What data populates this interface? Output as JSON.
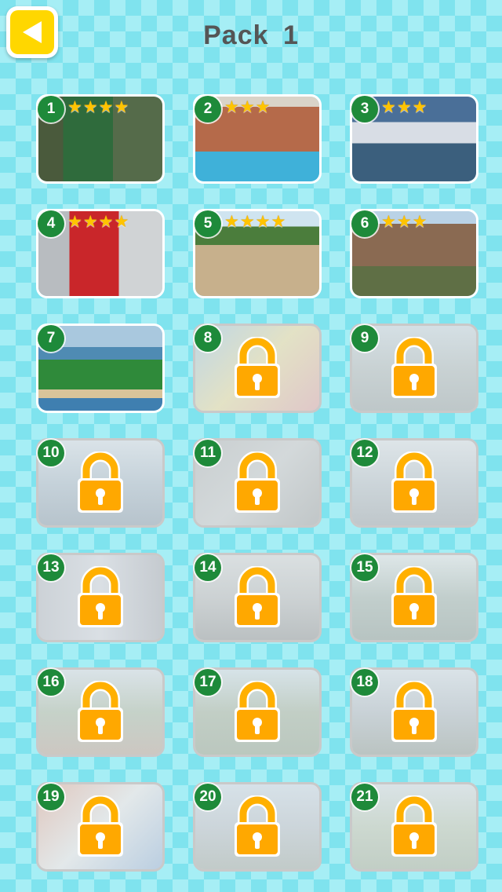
{
  "header": {
    "title": "Pack  1",
    "back_icon": "back-arrow-icon"
  },
  "colors": {
    "accent": "#ffd700",
    "badge": "#1e8a3a",
    "star": "#ffc400",
    "lock": "#ffa800"
  },
  "levels": [
    {
      "number": "1",
      "locked": false,
      "stars": 4,
      "scene": "cafe"
    },
    {
      "number": "2",
      "locked": false,
      "stars": 3,
      "scene": "pool"
    },
    {
      "number": "3",
      "locked": false,
      "stars": 3,
      "scene": "seaplane"
    },
    {
      "number": "4",
      "locked": false,
      "stars": 4,
      "scene": "traklok"
    },
    {
      "number": "5",
      "locked": false,
      "stars": 4,
      "scene": "horse"
    },
    {
      "number": "6",
      "locked": false,
      "stars": 3,
      "scene": "village"
    },
    {
      "number": "7",
      "locked": false,
      "stars": 0,
      "scene": "coast"
    },
    {
      "number": "8",
      "locked": true,
      "stars": 0,
      "scene": "toys"
    },
    {
      "number": "9",
      "locked": true,
      "stars": 0,
      "scene": "street"
    },
    {
      "number": "10",
      "locked": true,
      "stars": 0,
      "scene": "harbour"
    },
    {
      "number": "11",
      "locked": true,
      "stars": 0,
      "scene": "machine"
    },
    {
      "number": "12",
      "locked": true,
      "stars": 0,
      "scene": "houses"
    },
    {
      "number": "13",
      "locked": true,
      "stars": 0,
      "scene": "shop"
    },
    {
      "number": "14",
      "locked": true,
      "stars": 0,
      "scene": "market"
    },
    {
      "number": "15",
      "locked": true,
      "stars": 0,
      "scene": "tree"
    },
    {
      "number": "16",
      "locked": true,
      "stars": 0,
      "scene": "garden"
    },
    {
      "number": "17",
      "locked": true,
      "stars": 0,
      "scene": "fence"
    },
    {
      "number": "18",
      "locked": true,
      "stars": 0,
      "scene": "cottage"
    },
    {
      "number": "19",
      "locked": true,
      "stars": 0,
      "scene": "dice"
    },
    {
      "number": "20",
      "locked": true,
      "stars": 0,
      "scene": "skyline"
    },
    {
      "number": "21",
      "locked": true,
      "stars": 0,
      "scene": "field"
    }
  ]
}
